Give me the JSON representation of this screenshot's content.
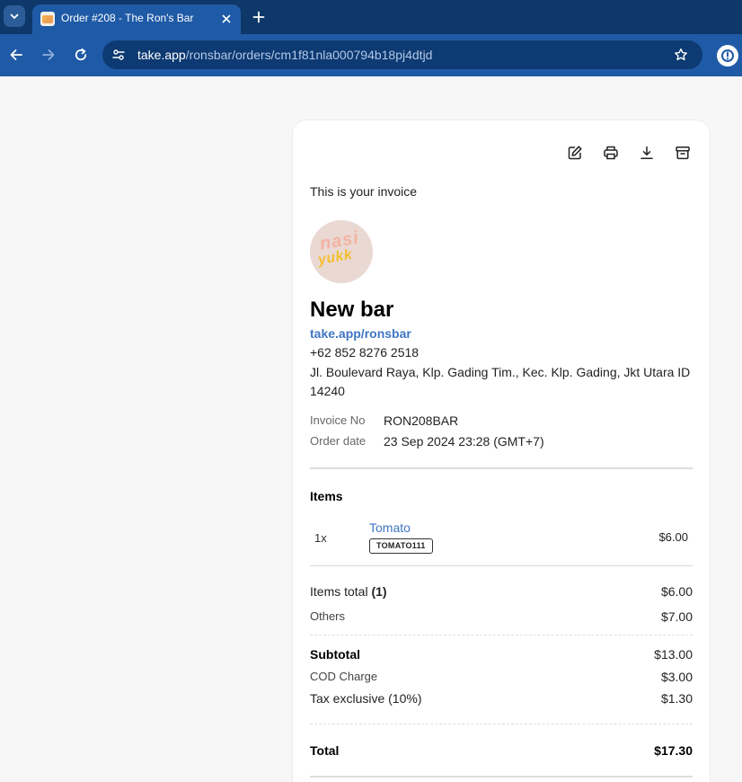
{
  "browser": {
    "tab_title": "Order #208 - The Ron's Bar",
    "url_host": "take.app",
    "url_path": "/ronsbar/orders/cm1f81nla000794b18pj4dtjd"
  },
  "invoice": {
    "intro": "This is your invoice",
    "logo_text_1": "nasi",
    "logo_text_2": "yukk",
    "store_name": "New bar",
    "store_link": "take.app/ronsbar",
    "store_phone": "+62 852 8276 2518",
    "store_address": "Jl. Boulevard Raya, Klp. Gading Tim., Kec. Klp. Gading, Jkt Utara ID 14240",
    "invoice_no_label": "Invoice No",
    "invoice_no": "RON208BAR",
    "order_date_label": "Order date",
    "order_date": "23 Sep 2024 23:28 (GMT+7)",
    "items_heading": "Items",
    "items": [
      {
        "qty": "1x",
        "name": "Tomato",
        "sku": "TOMATO111",
        "price": "$6.00"
      }
    ],
    "items_total_label": "Items total",
    "items_total_count": "(1)",
    "items_total": "$6.00",
    "others_label": "Others",
    "others": "$7.00",
    "subtotal_label": "Subtotal",
    "subtotal": "$13.00",
    "cod_label": "COD Charge",
    "cod": "$3.00",
    "tax_label": "Tax exclusive (10%)",
    "tax": "$1.30",
    "total_label": "Total",
    "total": "$17.30"
  },
  "icons": {
    "tab_search": "chevron-down-icon",
    "favicon": "store-favicon",
    "tab_close": "close-icon",
    "new_tab": "plus-icon",
    "back": "arrow-left-icon",
    "forward": "arrow-right-icon",
    "reload": "reload-icon",
    "site_info": "tune-icon",
    "bookmark": "star-icon",
    "extension": "extension-icon",
    "edit": "pencil-icon",
    "print": "printer-icon",
    "download": "download-icon",
    "archive": "archive-icon"
  },
  "colors": {
    "tabstrip": "#0e3869",
    "toolbar": "#1f5aa6",
    "omnibox": "#0d3a72",
    "link": "#3f76c3",
    "page_bg": "#f7f7f7"
  }
}
